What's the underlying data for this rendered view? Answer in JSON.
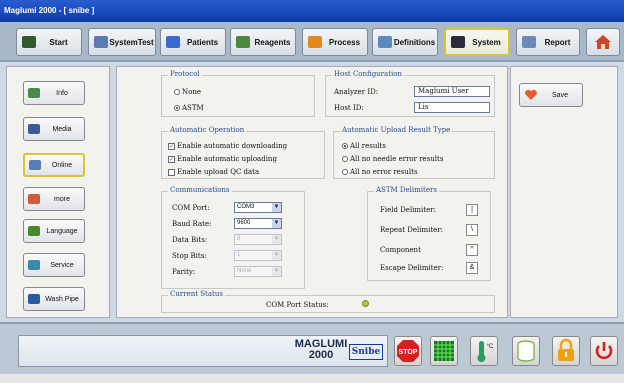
{
  "window": {
    "title": "Maglumi 2000 - [ snibe ]"
  },
  "topnav": [
    {
      "label": "Start"
    },
    {
      "label": "SystemTest"
    },
    {
      "label": "Patients"
    },
    {
      "label": "Reagents"
    },
    {
      "label": "Process"
    },
    {
      "label": "Definitions"
    },
    {
      "label": "System"
    },
    {
      "label": "Report"
    }
  ],
  "sidenav": [
    {
      "label": "Info"
    },
    {
      "label": "Media"
    },
    {
      "label": "Online"
    },
    {
      "label": "more"
    },
    {
      "label": "Language"
    },
    {
      "label": "Service"
    },
    {
      "label": "Wash Pipe"
    }
  ],
  "protocol": {
    "title": "Protocol",
    "option_none": "None",
    "option_astm": "ASTM",
    "selected": "ASTM"
  },
  "host": {
    "title": "Host Configuration",
    "analyzer_id_label": "Analyzer ID:",
    "analyzer_id_value": "Maglumi User",
    "host_id_label": "Host ID:",
    "host_id_value": "Lis"
  },
  "auto_op": {
    "title": "Automatic Operation",
    "download": "Enable automatic downloading",
    "upload": "Enable automatic uploading",
    "qc": "Enable upload QC data"
  },
  "upload_type": {
    "title": "Automatic Upload Result Type",
    "all": "All results",
    "no_needle": "All no needle error results",
    "no_error": "All no error results"
  },
  "comm": {
    "title": "Communications",
    "com_port_label": "COM Port:",
    "com_port_value": "COM3",
    "baud_label": "Baud Rate:",
    "baud_value": "9600",
    "data_bits_label": "Data Bits:",
    "data_bits_value": "8",
    "stop_bits_label": "Stop Bits:",
    "stop_bits_value": "1",
    "parity_label": "Parity:",
    "parity_value": "None"
  },
  "delims": {
    "title": "ASTM Delimiters",
    "field_label": "Field Delimiter:",
    "field_value": "|",
    "repeat_label": "Repeat Delimiter:",
    "repeat_value": "\\",
    "component_label": "Component",
    "component_value": "^",
    "escape_label": "Escape Delimiter:",
    "escape_value": "&"
  },
  "status": {
    "title": "Current Status",
    "com_port_status_label": "COM Port Status:"
  },
  "right": {
    "save_label": "Save"
  },
  "bottom": {
    "logo_line1": "MAGLUMI",
    "logo_line2": "2000",
    "brand": "Snibe",
    "stop_label": "STOP",
    "temp_label": "°C"
  },
  "colors": {
    "title_bar": "#1244b8",
    "accent_border": "#d8c437",
    "stop_red": "#d42020",
    "grid_green": "#22b022",
    "lock_orange": "#f0a010",
    "power_red": "#d02020",
    "status_led": "#b8c838"
  }
}
